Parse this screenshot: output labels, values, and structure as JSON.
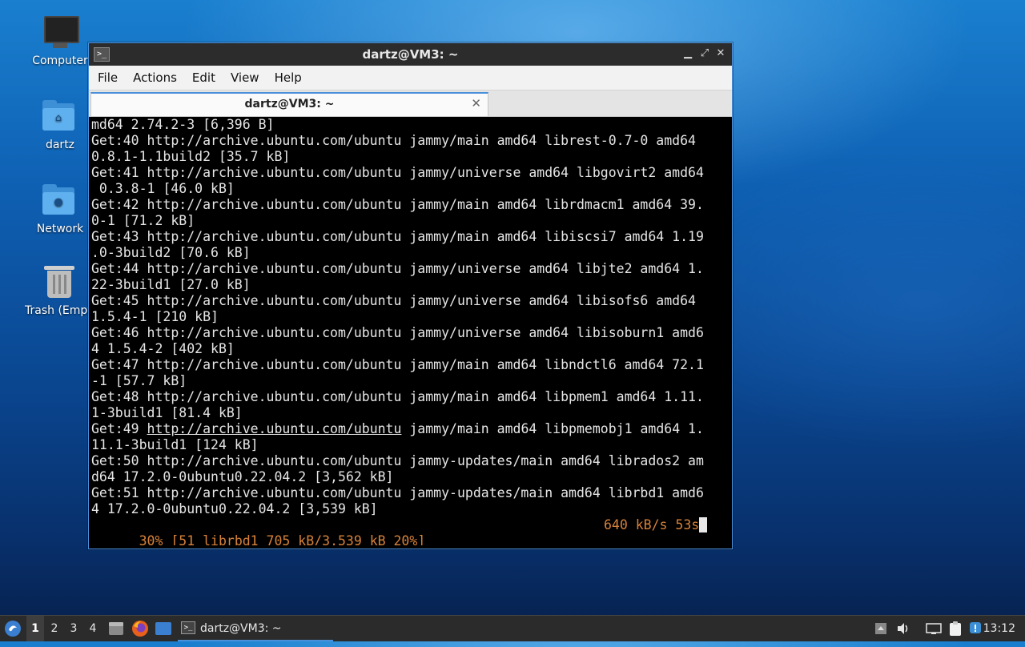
{
  "desktop": {
    "icons": [
      {
        "label": "Computer"
      },
      {
        "label": "dartz"
      },
      {
        "label": "Network"
      },
      {
        "label": "Trash (Empty)"
      }
    ]
  },
  "window": {
    "title": "dartz@VM3: ~",
    "menu": [
      "File",
      "Actions",
      "Edit",
      "View",
      "Help"
    ],
    "tab_label": "dartz@VM3: ~",
    "terminal": {
      "lines": [
        "md64 2.74.2-3 [6,396 B]",
        "Get:40 http://archive.ubuntu.com/ubuntu jammy/main amd64 librest-0.7-0 amd64",
        "0.8.1-1.1build2 [35.7 kB]",
        "Get:41 http://archive.ubuntu.com/ubuntu jammy/universe amd64 libgovirt2 amd64",
        " 0.3.8-1 [46.0 kB]",
        "Get:42 http://archive.ubuntu.com/ubuntu jammy/main amd64 librdmacm1 amd64 39.",
        "0-1 [71.2 kB]",
        "Get:43 http://archive.ubuntu.com/ubuntu jammy/main amd64 libiscsi7 amd64 1.19",
        ".0-3build2 [70.6 kB]",
        "Get:44 http://archive.ubuntu.com/ubuntu jammy/universe amd64 libjte2 amd64 1.",
        "22-3build1 [27.0 kB]",
        "Get:45 http://archive.ubuntu.com/ubuntu jammy/universe amd64 libisofs6 amd64",
        "1.5.4-1 [210 kB]",
        "Get:46 http://archive.ubuntu.com/ubuntu jammy/universe amd64 libisoburn1 amd6",
        "4 1.5.4-2 [402 kB]",
        "Get:47 http://archive.ubuntu.com/ubuntu jammy/main amd64 libndctl6 amd64 72.1",
        "-1 [57.7 kB]",
        "Get:48 http://archive.ubuntu.com/ubuntu jammy/main amd64 libpmem1 amd64 1.11.",
        "1-3build1 [81.4 kB]"
      ],
      "link_line": {
        "prefix": "Get:49 ",
        "url": "http://archive.ubuntu.com/ubuntu",
        "suffix": " jammy/main amd64 libpmemobj1 amd64 1."
      },
      "lines_after": [
        "11.1-3build1 [124 kB]",
        "Get:50 http://archive.ubuntu.com/ubuntu jammy-updates/main amd64 librados2 am",
        "d64 17.2.0-0ubuntu0.22.04.2 [3,562 kB]",
        "Get:51 http://archive.ubuntu.com/ubuntu jammy-updates/main amd64 librbd1 amd6",
        "4 17.2.0-0ubuntu0.22.04.2 [3,539 kB]"
      ],
      "progress": {
        "left": "30% [51 librbd1 705 kB/3,539 kB 20%]",
        "right": "640 kB/s 53s",
        "color": "#d7823a"
      }
    }
  },
  "taskbar": {
    "workspaces": [
      "1",
      "2",
      "3",
      "4"
    ],
    "active_workspace": "1",
    "task_label": "dartz@VM3: ~",
    "clock": "13:12"
  },
  "colors": {
    "accent": "#4a90d9",
    "taskbar_bg": "#2b2b2b",
    "terminal_bg": "#000000"
  }
}
